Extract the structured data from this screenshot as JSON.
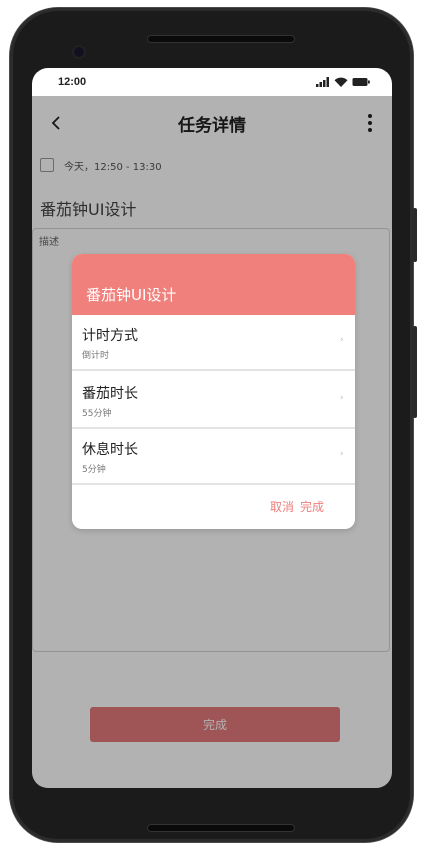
{
  "status_bar": {
    "time": "12:00",
    "signal_icon": "signal-icon",
    "wifi_icon": "wifi-icon",
    "battery_icon": "battery-icon"
  },
  "header": {
    "title": "任务详情",
    "back_icon": "chevron-left-icon",
    "more_icon": "more-vertical-icon"
  },
  "task": {
    "time": "今天，12:50 - 13:30",
    "title": "番茄钟UI设计",
    "description_label": "描述"
  },
  "bottom_button": {
    "label": "完成"
  },
  "dialog": {
    "title": "番茄钟UI设计",
    "rows": [
      {
        "label": "计时方式",
        "value": "倒计时",
        "chevron": "›"
      },
      {
        "label": "番茄时长",
        "value": "55分钟",
        "chevron": "›"
      },
      {
        "label": "休息时长",
        "value": "5分钟",
        "chevron": "›"
      }
    ],
    "cancel_label": "取消",
    "confirm_label": "完成"
  },
  "colors": {
    "accent": "#ef807c",
    "button": "#e4797a",
    "overlay": "rgba(0,0,0,0.30)"
  }
}
